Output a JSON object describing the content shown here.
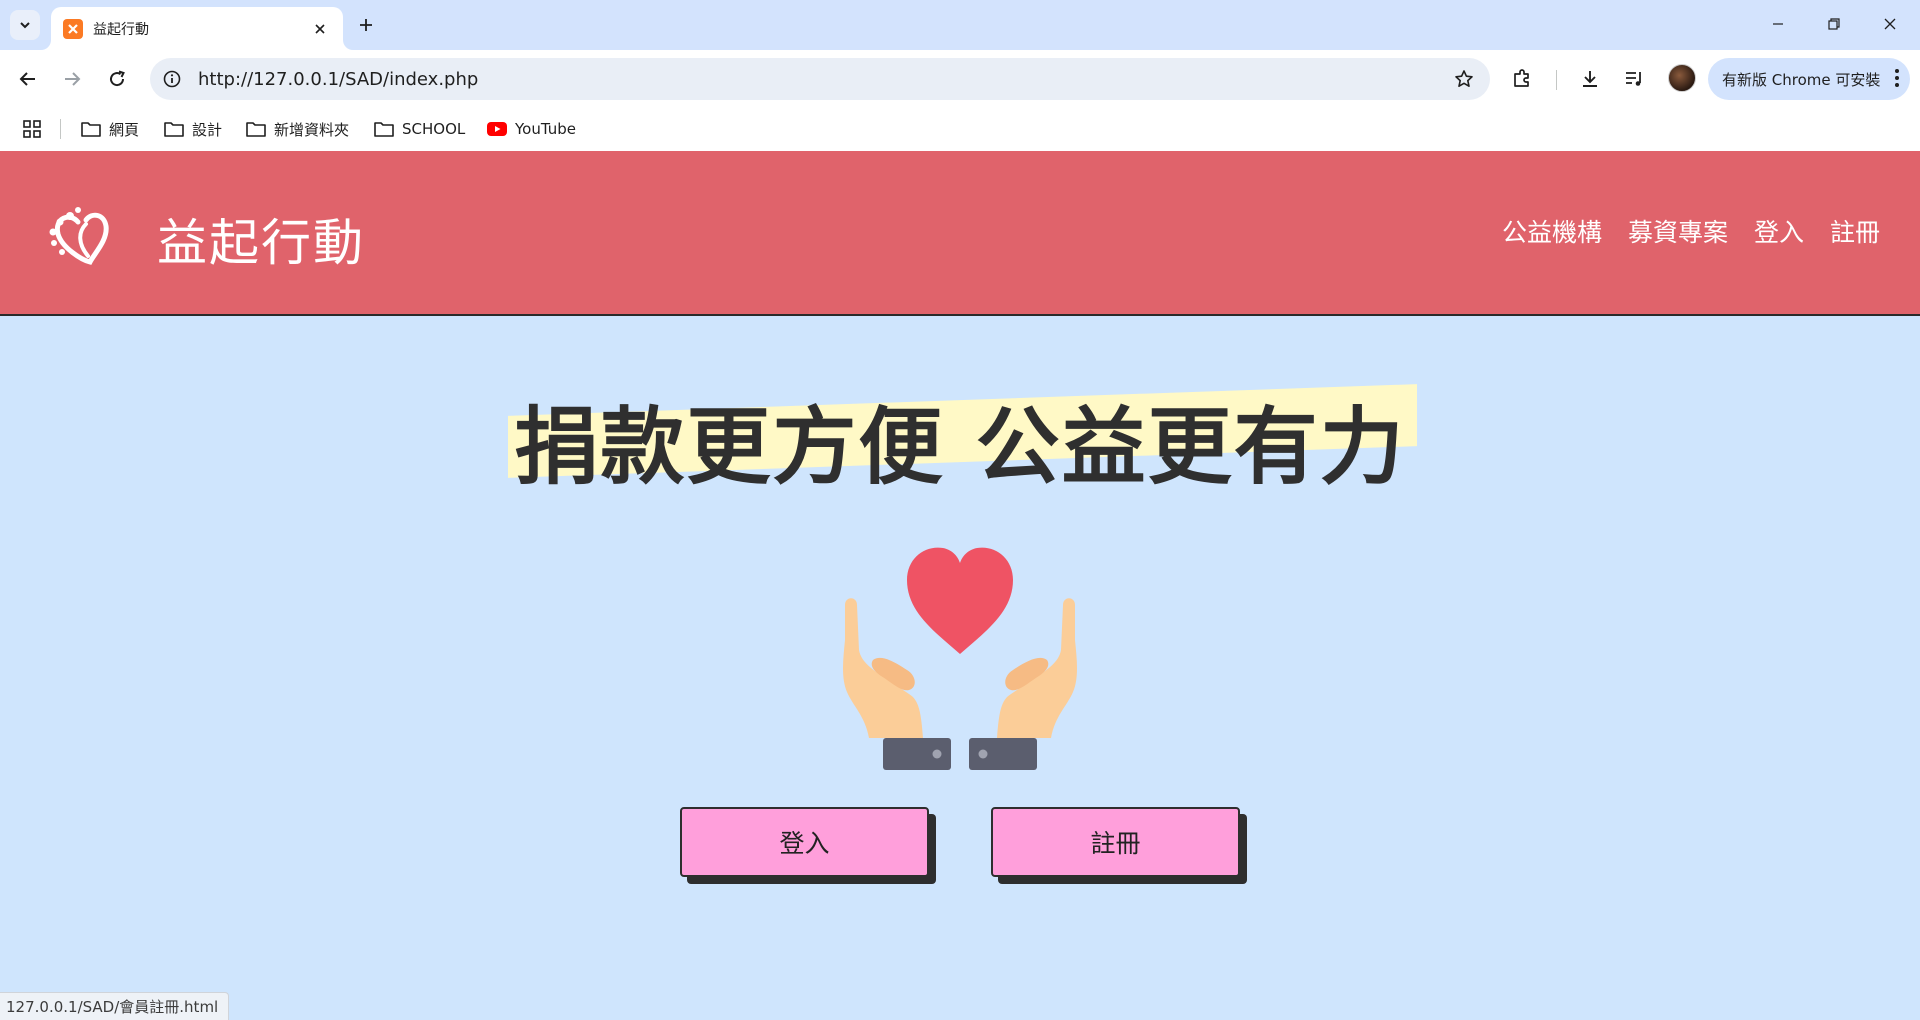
{
  "browser": {
    "tab_title": "益起行動",
    "url": "http://127.0.0.1/SAD/index.php",
    "update_label": "有新版 Chrome 可安裝",
    "bookmarks": [
      {
        "label": "網頁",
        "icon": "folder-icon"
      },
      {
        "label": "設計",
        "icon": "folder-icon"
      },
      {
        "label": "新增資料夾",
        "icon": "folder-icon"
      },
      {
        "label": "SCHOOL",
        "icon": "folder-icon"
      },
      {
        "label": "YouTube",
        "icon": "youtube-icon"
      }
    ],
    "status_url": "127.0.0.1/SAD/會員註冊.html"
  },
  "site": {
    "title": "益起行動",
    "nav": [
      "公益機構",
      "募資專案",
      "登入",
      "註冊"
    ],
    "hero_title": "捐款更方便 公益更有力",
    "buttons": {
      "login": "登入",
      "register": "註冊"
    }
  },
  "colors": {
    "header_bg": "#e0636b",
    "page_bg": "#cfe5fd",
    "button_bg": "#ff9fdb",
    "highlight": "#fff9c6",
    "heart": "#ef5364",
    "hand": "#fbcd98"
  }
}
